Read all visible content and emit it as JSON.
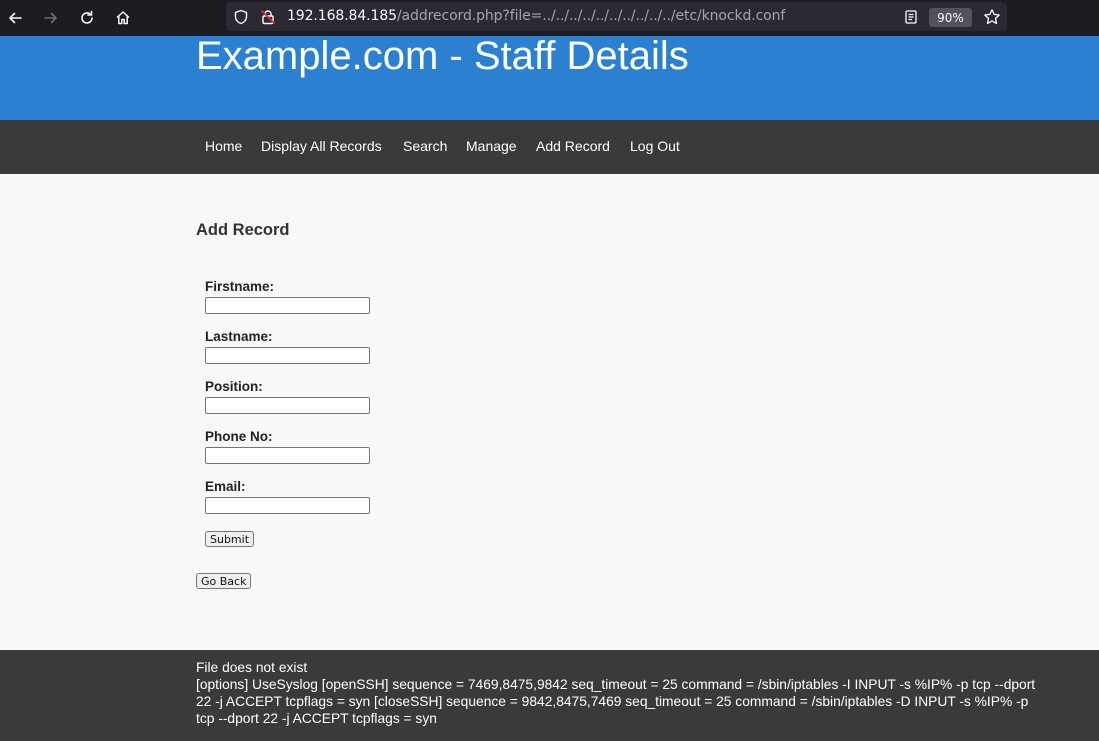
{
  "browser": {
    "url_host": "192.168.84.185",
    "url_path": "/addrecord.php?file=../../../../../../../../../../etc/knockd.conf",
    "zoom": "90%",
    "icons": [
      "back-arrow-icon",
      "forward-arrow-icon",
      "reload-icon",
      "home-icon",
      "shield-icon",
      "insecure-lock-icon",
      "reader-view-icon",
      "bookmark-star-icon"
    ]
  },
  "header": {
    "title": "Example.com - Staff Details",
    "bg_color": "#2b80d1"
  },
  "nav": {
    "items": [
      {
        "label": "Home"
      },
      {
        "label": "Display All Records"
      },
      {
        "label": "Search"
      },
      {
        "label": "Manage"
      },
      {
        "label": "Add Record"
      },
      {
        "label": "Log Out"
      }
    ]
  },
  "form": {
    "title": "Add Record",
    "fields": [
      {
        "label": "Firstname:",
        "value": ""
      },
      {
        "label": "Lastname:",
        "value": ""
      },
      {
        "label": "Position:",
        "value": ""
      },
      {
        "label": "Phone No:",
        "value": ""
      },
      {
        "label": "Email:",
        "value": ""
      }
    ],
    "submit_label": "Submit",
    "back_label": "Go Back"
  },
  "footer": {
    "line1": "File does not exist",
    "line2": "[options] UseSyslog [openSSH] sequence = 7469,8475,9842 seq_timeout = 25 command = /sbin/iptables -I INPUT -s %IP% -p tcp --dport 22 -j ACCEPT tcpflags = syn [closeSSH] sequence = 9842,8475,7469 seq_timeout = 25 command = /sbin/iptables -D INPUT -s %IP% -p tcp --dport 22 -j ACCEPT tcpflags = syn"
  }
}
